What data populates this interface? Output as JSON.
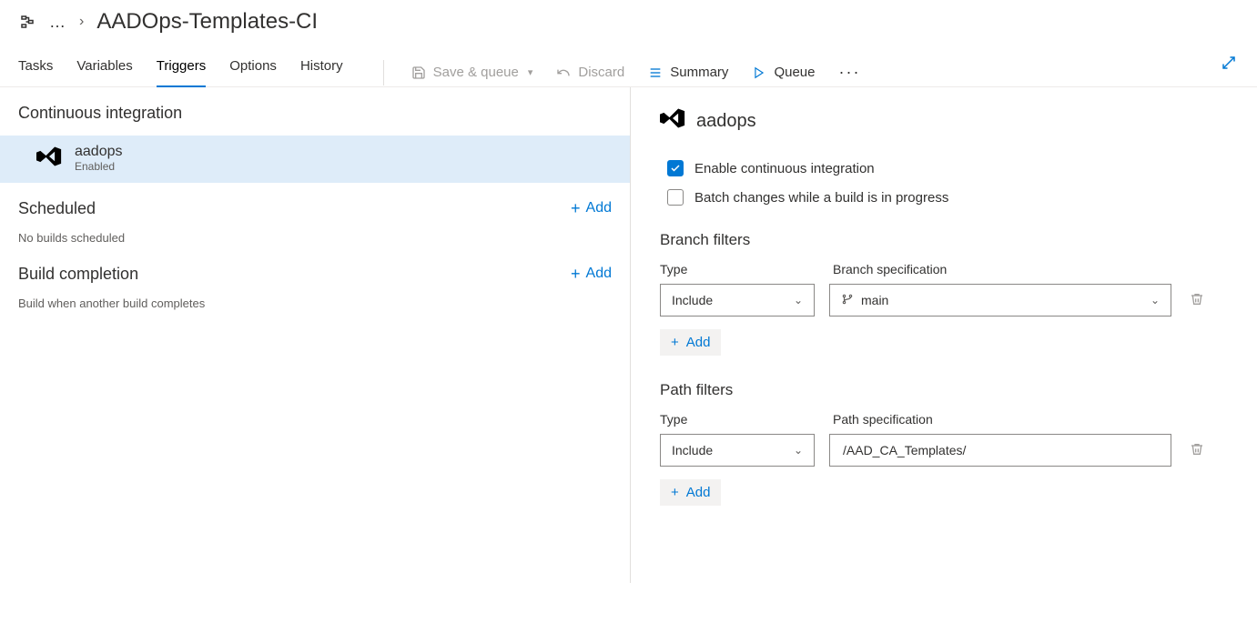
{
  "header": {
    "title": "AADOps-Templates-CI"
  },
  "tabs": {
    "tasks": "Tasks",
    "variables": "Variables",
    "triggers": "Triggers",
    "options": "Options",
    "history": "History"
  },
  "toolbar": {
    "save_queue": "Save & queue",
    "discard": "Discard",
    "summary": "Summary",
    "queue": "Queue"
  },
  "left": {
    "ci_heading": "Continuous integration",
    "repo_name": "aadops",
    "repo_status": "Enabled",
    "scheduled_heading": "Scheduled",
    "scheduled_empty": "No builds scheduled",
    "completion_heading": "Build completion",
    "completion_empty": "Build when another build completes",
    "add_label": "Add"
  },
  "right": {
    "source_name": "aadops",
    "enable_ci_label": "Enable continuous integration",
    "batch_label": "Batch changes while a build is in progress",
    "branch_filters_heading": "Branch filters",
    "path_filters_heading": "Path filters",
    "type_label": "Type",
    "branch_spec_label": "Branch specification",
    "path_spec_label": "Path specification",
    "add_label": "Add",
    "branch_filters": [
      {
        "type": "Include",
        "branch": "main"
      }
    ],
    "path_filters": [
      {
        "type": "Include",
        "path": "/AAD_CA_Templates/"
      }
    ]
  }
}
